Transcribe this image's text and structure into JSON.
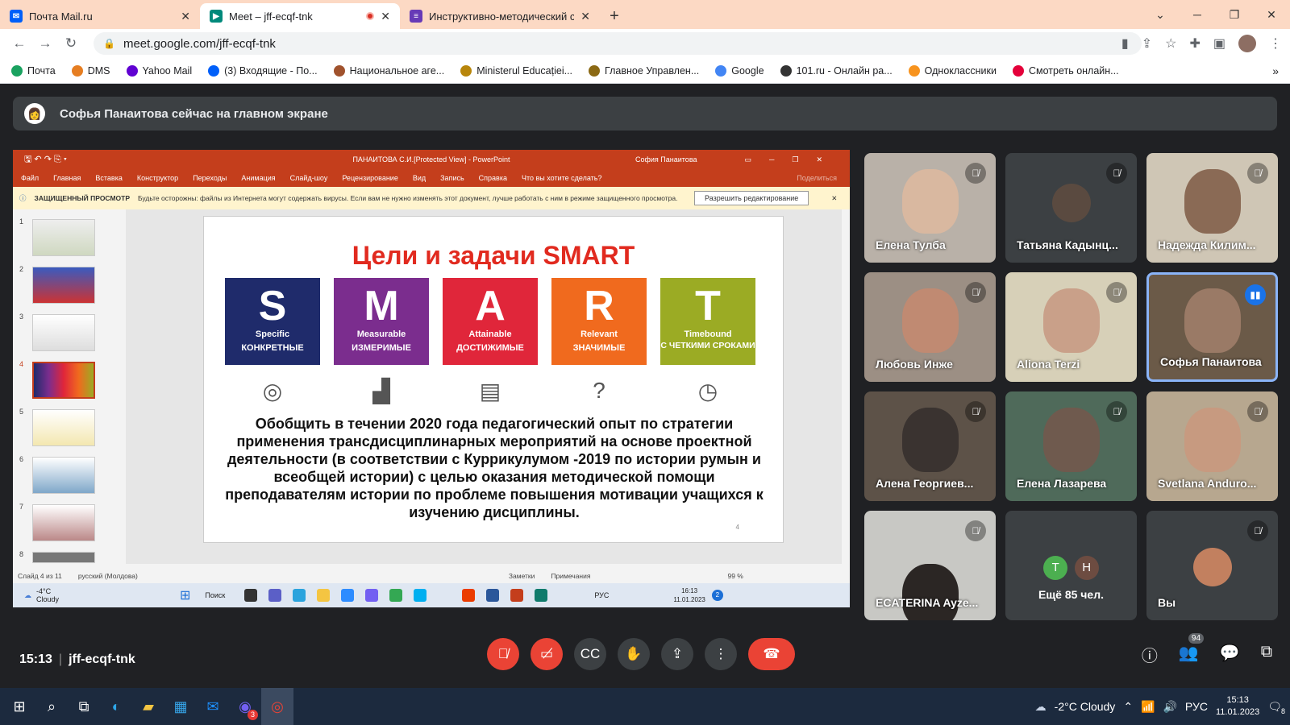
{
  "browser": {
    "tabs": [
      {
        "title": "Почта Mail.ru",
        "icon": "mail-icon",
        "color": "#005ff9"
      },
      {
        "title": "Meet – jff-ecqf-tnk",
        "icon": "meet-icon",
        "color": "#00897b"
      },
      {
        "title": "Инструктивно-методический се",
        "icon": "form-icon",
        "color": "#673ab7"
      }
    ],
    "url": "meet.google.com/jff-ecqf-tnk",
    "bookmarks": [
      "Почта",
      "DMS",
      "Yahoo Mail",
      "(3) Входящие - По...",
      "Национальное аге...",
      "Ministerul Educației...",
      "Главное Управлен...",
      "Google",
      "101.ru - Онлайн ра...",
      "Одноклассники",
      "Смотреть онлайн..."
    ]
  },
  "banner": {
    "text": "Софья Панаитова сейчас на главном экране"
  },
  "powerpoint": {
    "title": "ПАНАИТОВА С.И.[Protected View] - PowerPoint",
    "user": "София Панаитова",
    "menu": [
      "Файл",
      "Главная",
      "Вставка",
      "Конструктор",
      "Переходы",
      "Анимация",
      "Слайд-шоу",
      "Рецензирование",
      "Вид",
      "Запись",
      "Справка",
      "Что вы хотите сделать?"
    ],
    "share": "Поделиться",
    "warning_label": "ЗАЩИЩЕННЫЙ ПРОСМОТР",
    "warning_text": "Будьте осторожны: файлы из Интернета могут содержать вирусы. Если вам не нужно изменять этот документ, лучше работать с ним в режиме защищенного просмотра.",
    "enable_edit": "Разрешить редактирование",
    "slide_numbers": [
      "1",
      "2",
      "3",
      "4",
      "5",
      "6",
      "7",
      "8"
    ],
    "status": {
      "slide": "Слайд 4 из 11",
      "lang": "русский (Молдова)",
      "notes": "Заметки",
      "comments": "Примечания",
      "zoom": "99 %"
    },
    "slide": {
      "title": "Цели и задачи SMART",
      "page": "4",
      "boxes": [
        {
          "letter": "S",
          "en": "Specific",
          "ru": "КОНКРЕТНЫЕ",
          "color": "#1f2b6b",
          "icon": "◎"
        },
        {
          "letter": "M",
          "en": "Measurable",
          "ru": "ИЗМЕРИМЫЕ",
          "color": "#7b2d8e",
          "icon": "📈"
        },
        {
          "letter": "A",
          "en": "Attainable",
          "ru": "ДОСТИЖИМЫЕ",
          "color": "#e0263a",
          "icon": "📋"
        },
        {
          "letter": "R",
          "en": "Relevant",
          "ru": "ЗНАЧИМЫЕ",
          "color": "#f06a1e",
          "icon": "?"
        },
        {
          "letter": "T",
          "en": "Timebound",
          "ru": "С ЧЕТКИМИ СРОКАМИ",
          "color": "#9bab24",
          "icon": "◷"
        }
      ],
      "body": "Обобщить в течении 2020 года педагогический опыт по стратегии применения трансдисциплинарных мероприятий на основе проектной деятельности (в соответствии с Куррикулумом -2019 по истории румын и всеобщей истории) с целью оказания  методической помощи преподавателям истории по проблеме повышения мотивации учащихся к изучению дисциплины."
    },
    "taskbar": {
      "temp": "-4°C",
      "weather": "Cloudy",
      "search": "Поиск",
      "lang": "РУС",
      "time": "16:13",
      "date": "11.01.2023",
      "notif": "2"
    }
  },
  "participants": [
    {
      "name": "Елена Тулба",
      "muted": true,
      "bg": "#b9b1a8",
      "face": "#d9b8a0"
    },
    {
      "name": "Татьяна Кадынц...",
      "muted": true,
      "bg": "#3c4043",
      "avatar": true
    },
    {
      "name": "Надежда Килим...",
      "muted": true,
      "bg": "#cfc6b5",
      "face": "#8a6a55"
    },
    {
      "name": "Любовь Инже",
      "muted": true,
      "bg": "#9c8f84",
      "face": "#c08a72"
    },
    {
      "name": "Aliona Terzi",
      "muted": true,
      "bg": "#d7d0b8",
      "face": "#c9a089"
    },
    {
      "name": "Софья Панаитова",
      "muted": false,
      "speaking": true,
      "bg": "#6b5a48",
      "face": "#9a7a66"
    },
    {
      "name": "Алена Георгиев...",
      "muted": true,
      "bg": "#5d5248",
      "face": "#3a3330"
    },
    {
      "name": "Елена Лазарева",
      "muted": true,
      "bg": "#4f6a5a",
      "face": "#6f5a4e"
    },
    {
      "name": "Svetlana Anduro...",
      "muted": true,
      "bg": "#b7a78f",
      "face": "#c79a80"
    },
    {
      "name": "ECATERINA Ayze...",
      "muted": true,
      "bg": "#c8c8c4",
      "face": "#2b2624"
    },
    {
      "name": "Ещё 85 чел.",
      "more": true,
      "initials": [
        "T",
        "H"
      ]
    },
    {
      "name": "Вы",
      "muted": true,
      "self": true
    }
  ],
  "meeting": {
    "time": "15:13",
    "code": "jff-ecqf-tnk",
    "people_count": "94"
  },
  "windows": {
    "weather": "-2°C  Cloudy",
    "lang": "РУС",
    "time": "15:13",
    "date": "11.01.2023",
    "notif": "8",
    "viber_badge": "3"
  }
}
